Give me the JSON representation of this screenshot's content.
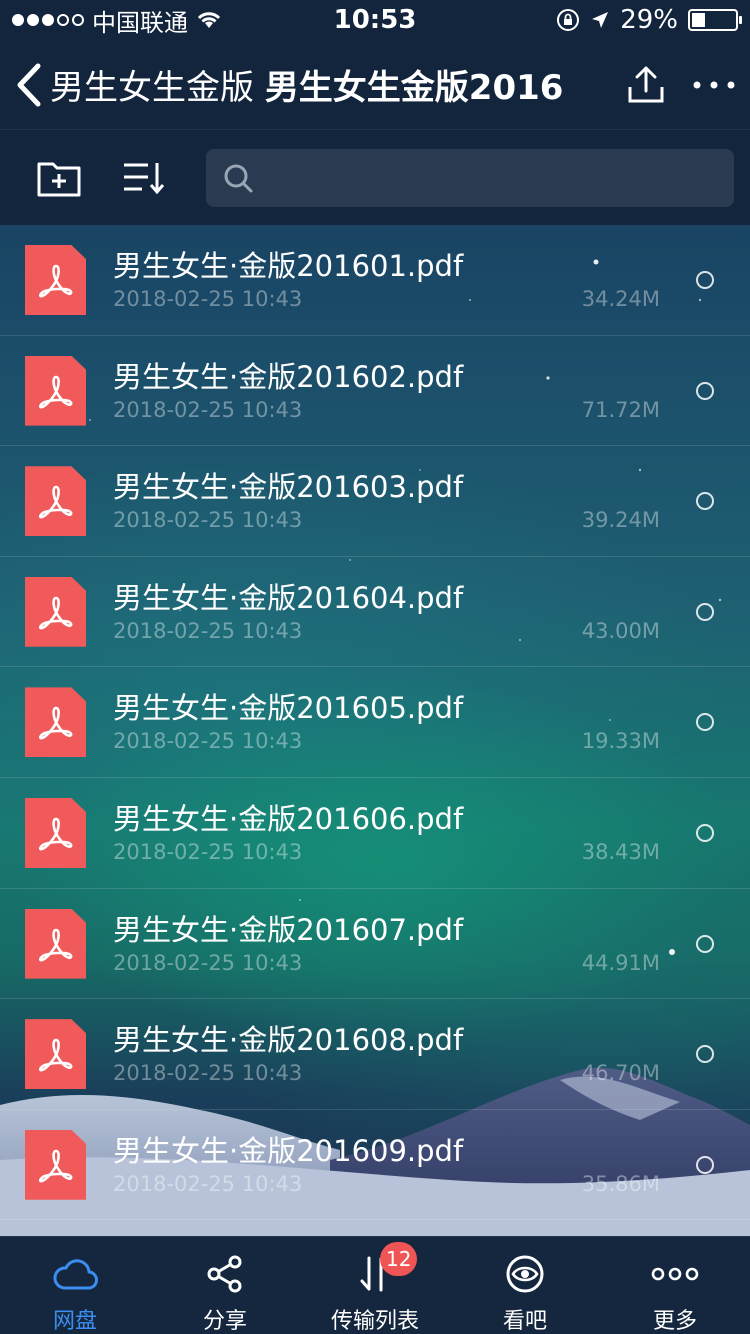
{
  "status_bar": {
    "carrier": "中国联通",
    "time": "10:53",
    "battery": "29%",
    "battery_level": 0.29
  },
  "nav": {
    "folder_parent": "男生女生金版",
    "folder_title": "男生女生金版2016"
  },
  "search": {
    "placeholder": ""
  },
  "files": [
    {
      "name": "男生女生·金版201601.pdf",
      "date": "2018-02-25 10:43",
      "size": "34.24M"
    },
    {
      "name": "男生女生·金版201602.pdf",
      "date": "2018-02-25 10:43",
      "size": "71.72M"
    },
    {
      "name": "男生女生·金版201603.pdf",
      "date": "2018-02-25 10:43",
      "size": "39.24M"
    },
    {
      "name": "男生女生·金版201604.pdf",
      "date": "2018-02-25 10:43",
      "size": "43.00M"
    },
    {
      "name": "男生女生·金版201605.pdf",
      "date": "2018-02-25 10:43",
      "size": "19.33M"
    },
    {
      "name": "男生女生·金版201606.pdf",
      "date": "2018-02-25 10:43",
      "size": "38.43M"
    },
    {
      "name": "男生女生·金版201607.pdf",
      "date": "2018-02-25 10:43",
      "size": "44.91M"
    },
    {
      "name": "男生女生·金版201608.pdf",
      "date": "2018-02-25 10:43",
      "size": "46.70M"
    },
    {
      "name": "男生女生·金版201609.pdf",
      "date": "2018-02-25 10:43",
      "size": "35.86M"
    }
  ],
  "tabs": [
    {
      "label": "网盘",
      "icon": "cloud-icon",
      "active": true
    },
    {
      "label": "分享",
      "icon": "share-icon",
      "active": false
    },
    {
      "label": "传输列表",
      "icon": "transfer-icon",
      "active": false,
      "badge": "12"
    },
    {
      "label": "看吧",
      "icon": "eye-icon",
      "active": false
    },
    {
      "label": "更多",
      "icon": "more-icon",
      "active": false
    }
  ],
  "colors": {
    "accent": "#3b8ef0",
    "pdf_red": "#f05a5a",
    "badge_red": "#f05555",
    "bar_bg": "#13253c"
  }
}
